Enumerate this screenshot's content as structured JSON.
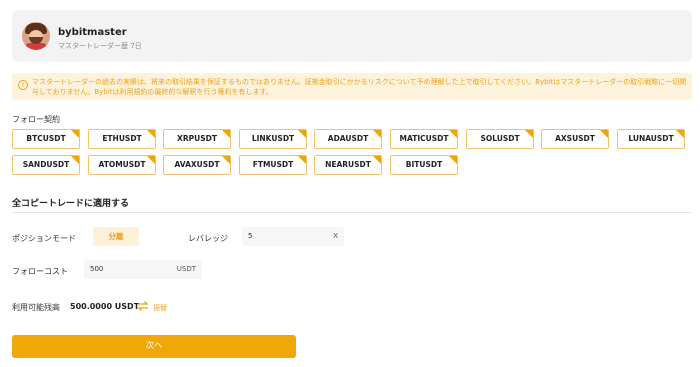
{
  "header": {
    "username": "bybitmaster",
    "subtitle": "マスタートレーダー歴 7日"
  },
  "warning": {
    "text": "マスタートレーダーの過去の実績は、将来の取引結果を保証するものではありません。証拠金取引にかかるリスクについて予め理解した上で取引してください。Bybitはマスタートレーダーの取引戦略に一切関与しておりません。Bybitは利用規約の最終的な解釈を行う権利を有します。"
  },
  "follow": {
    "label": "フォロー契約",
    "pairs": [
      "BTCUSDT",
      "ETHUSDT",
      "XRPUSDT",
      "LINKUSDT",
      "ADAUSDT",
      "MATICUSDT",
      "SOLUSDT",
      "AXSUSDT",
      "LUNAUSDT",
      "SANDUSDT",
      "ATOMUSDT",
      "AVAXUSDT",
      "FTMUSDT",
      "NEARUSDT",
      "BITUSDT"
    ]
  },
  "settings": {
    "title": "全コピートレードに適用する",
    "position_mode_label": "ポジションモード",
    "position_mode_value": "分離",
    "leverage_label": "レバレッジ",
    "leverage_value": "5",
    "leverage_unit": "X",
    "follow_cost_label": "フォローコスト",
    "follow_cost_value": "500",
    "follow_cost_unit": "USDT"
  },
  "balance": {
    "label": "利用可能残高",
    "value": "500.0000 USDT",
    "transfer_label": "振替"
  },
  "next_button": "次へ",
  "colors": {
    "accent": "#f0a70a",
    "warning_bg": "#fdf3dd"
  }
}
